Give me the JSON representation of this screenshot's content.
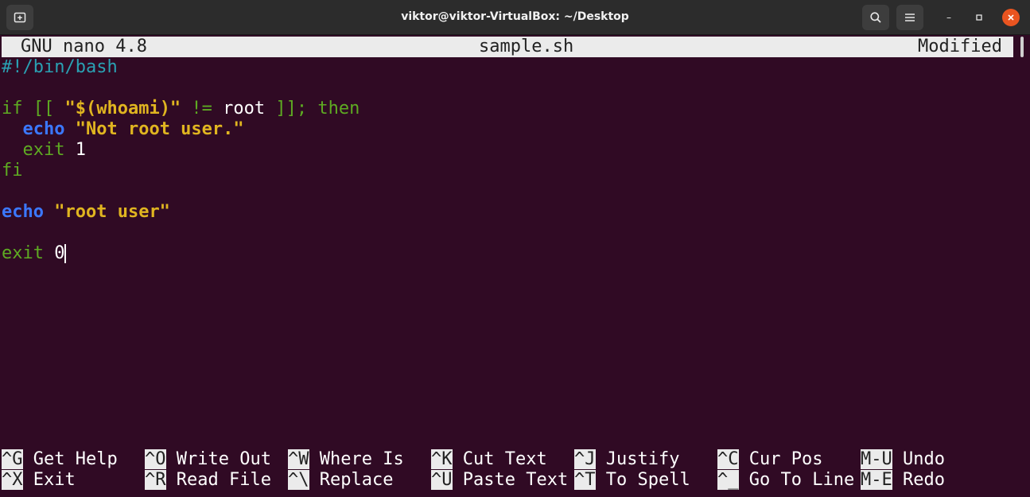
{
  "window": {
    "title": "viktor@viktor-VirtualBox: ~/Desktop",
    "new_tab_icon": "new-tab-icon",
    "search_icon": "search-icon",
    "menu_icon": "hamburger-menu-icon",
    "minimize": "–",
    "maximize": "▫",
    "close": "✕",
    "close_color": "#e95420"
  },
  "nano": {
    "version": "GNU nano 4.8",
    "filename": "sample.sh",
    "status": "Modified"
  },
  "code": {
    "l1": "#!/bin/bash",
    "l3_if": "if [[ ",
    "l3_str": "\"$(whoami)\"",
    "l3_op": " != ",
    "l3_root": "root",
    "l3_end": " ]]; then",
    "l4_echo": "echo",
    "l4_str": "\"Not root user.\"",
    "l5_exit": "exit",
    "l5_num": "1",
    "l6": "fi",
    "l8_echo": "echo",
    "l8_str": "\"root user\"",
    "l10_exit": "exit",
    "l10_num": "0"
  },
  "shortcuts": {
    "row1": [
      {
        "key": "^G",
        "label": "Get Help"
      },
      {
        "key": "^O",
        "label": "Write Out"
      },
      {
        "key": "^W",
        "label": "Where Is"
      },
      {
        "key": "^K",
        "label": "Cut Text"
      },
      {
        "key": "^J",
        "label": "Justify"
      },
      {
        "key": "^C",
        "label": "Cur Pos"
      },
      {
        "key": "M-U",
        "label": "Undo"
      }
    ],
    "row2": [
      {
        "key": "^X",
        "label": "Exit"
      },
      {
        "key": "^R",
        "label": "Read File"
      },
      {
        "key": "^\\",
        "label": "Replace"
      },
      {
        "key": "^U",
        "label": "Paste Text"
      },
      {
        "key": "^T",
        "label": "To Spell"
      },
      {
        "key": "^_",
        "label": "Go To Line"
      },
      {
        "key": "M-E",
        "label": "Redo"
      }
    ]
  }
}
